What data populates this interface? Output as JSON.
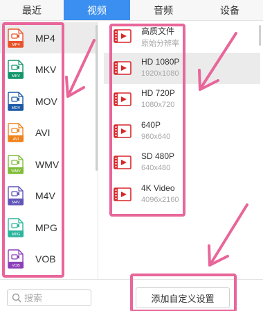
{
  "tabs": [
    {
      "label": "最近"
    },
    {
      "label": "视频"
    },
    {
      "label": "音频"
    },
    {
      "label": "设备"
    }
  ],
  "active_tab": "视频",
  "formats": [
    {
      "name": "MP4",
      "color": "#e8542a"
    },
    {
      "name": "MKV",
      "color": "#12956a"
    },
    {
      "name": "MOV",
      "color": "#1c5aa6"
    },
    {
      "name": "AVI",
      "color": "#f0821e"
    },
    {
      "name": "WMV",
      "color": "#7fbd3a"
    },
    {
      "name": "M4V",
      "color": "#5f55b8"
    },
    {
      "name": "MPG",
      "color": "#2cb59e"
    },
    {
      "name": "VOB",
      "color": "#8b3fb8"
    }
  ],
  "selected_format": "MP4",
  "presets": [
    {
      "title": "高质文件",
      "sub": "原始分辨率"
    },
    {
      "title": "HD 1080P",
      "sub": "1920x1080"
    },
    {
      "title": "HD 720P",
      "sub": "1080x720"
    },
    {
      "title": "640P",
      "sub": "960x640"
    },
    {
      "title": "SD 480P",
      "sub": "640x480"
    },
    {
      "title": "4K Video",
      "sub": "4096x2160"
    }
  ],
  "selected_preset": "HD 1080P",
  "search": {
    "placeholder": "搜索"
  },
  "custom_button": {
    "label": "添加自定义设置"
  },
  "colors": {
    "accent": "#3a8ff0",
    "annotation": "#e8669a",
    "preset_icon": "#d8272c"
  }
}
